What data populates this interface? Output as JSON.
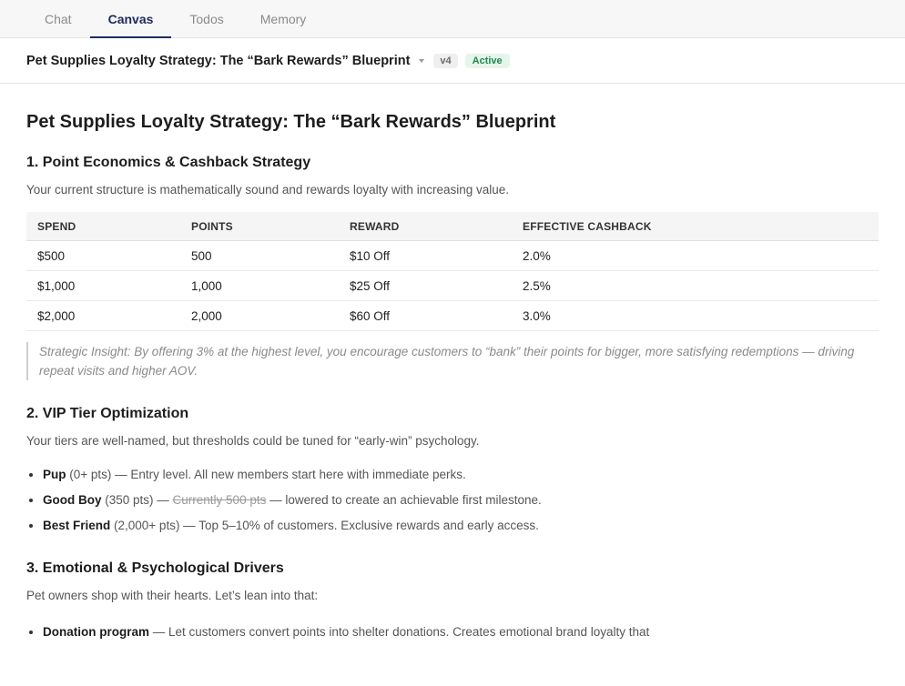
{
  "tabs": [
    {
      "label": "Chat",
      "active": false
    },
    {
      "label": "Canvas",
      "active": true
    },
    {
      "label": "Todos",
      "active": false
    },
    {
      "label": "Memory",
      "active": false
    }
  ],
  "doc": {
    "title": "Pet Supplies Loyalty Strategy: The “Bark Rewards” Blueprint",
    "version": "v4",
    "status": "Active"
  },
  "body": {
    "heading": "Pet Supplies Loyalty Strategy: The “Bark Rewards” Blueprint",
    "section1": {
      "title": "1. Point Economics & Cashback Strategy",
      "lead": "Your current structure is mathematically sound and rewards loyalty with increasing value.",
      "table": {
        "headers": [
          "SPEND",
          "POINTS",
          "REWARD",
          "EFFECTIVE CASHBACK"
        ],
        "rows": [
          [
            "$500",
            "500",
            "$10 Off",
            "2.0%"
          ],
          [
            "$1,000",
            "1,000",
            "$25 Off",
            "2.5%"
          ],
          [
            "$2,000",
            "2,000",
            "$60 Off",
            "3.0%"
          ]
        ]
      },
      "insight": "Strategic Insight: By offering 3% at the highest level, you encourage customers to “bank” their points for bigger, more satisfying redemptions — driving repeat visits and higher AOV."
    },
    "section2": {
      "title": "2. VIP Tier Optimization",
      "lead": "Your tiers are well-named, but thresholds could be tuned for “early-win” psychology.",
      "tiers": [
        {
          "name": "Pup",
          "detail": " (0+ pts) — Entry level. All new members start here with immediate perks."
        },
        {
          "name": "Good Boy",
          "detail_before": " (350 pts) — ",
          "strike": "Currently 500 pts",
          "detail_after": " — lowered to create an achievable first milestone."
        },
        {
          "name": "Best Friend",
          "detail": " (2,000+ pts) — Top 5–10% of customers. Exclusive rewards and early access."
        }
      ]
    },
    "section3": {
      "title": "3. Emotional & Psychological Drivers",
      "lead": "Pet owners shop with their hearts. Let’s lean into that:",
      "items": [
        {
          "name": "Donation program",
          "detail": " — Let customers convert points into shelter donations. Creates emotional brand loyalty that"
        }
      ]
    }
  }
}
